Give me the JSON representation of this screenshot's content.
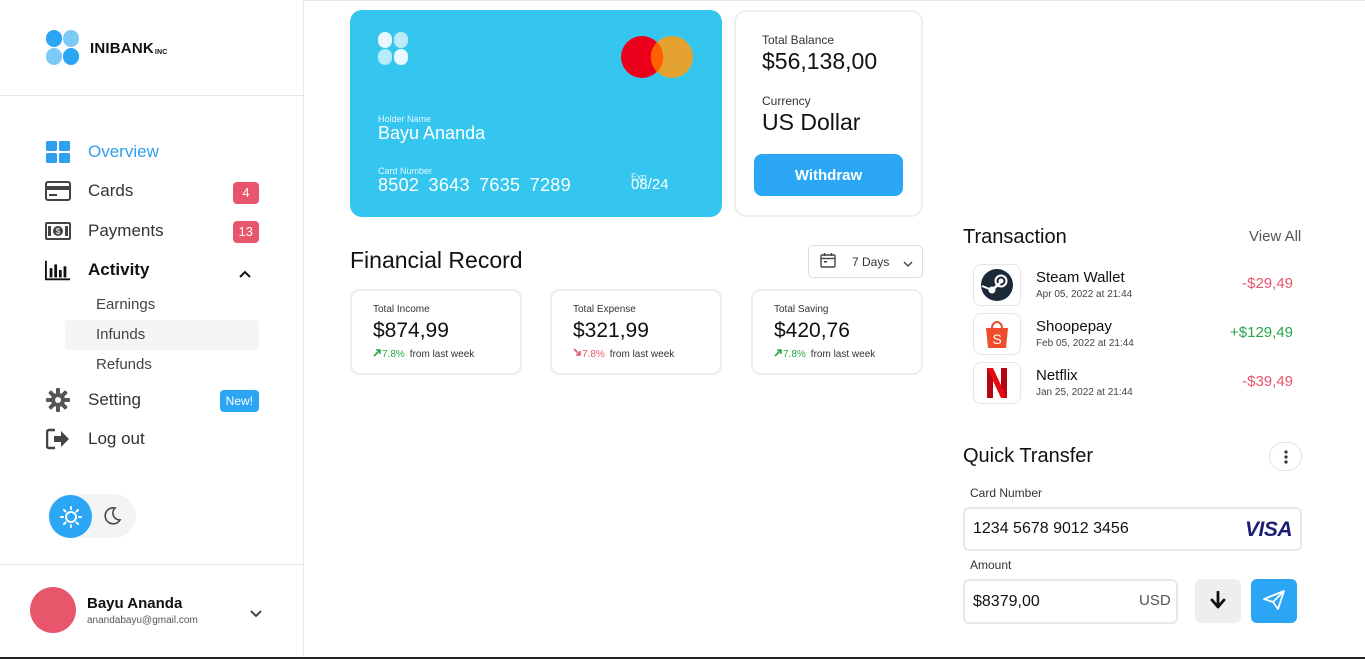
{
  "brand": {
    "name": "INIBANK",
    "suffix": "INC"
  },
  "sidebar": {
    "nav": [
      {
        "label": "Overview",
        "icon": "grid-icon",
        "active": true
      },
      {
        "label": "Cards",
        "icon": "credit-card-icon",
        "badge": "4"
      },
      {
        "label": "Payments",
        "icon": "banknote-icon",
        "badge": "13"
      },
      {
        "label": "Activity",
        "icon": "bar-chart-icon",
        "expanded": true
      }
    ],
    "activity_sub": [
      {
        "label": "Earnings"
      },
      {
        "label": "Infunds",
        "selected": true
      },
      {
        "label": "Refunds"
      }
    ],
    "setting": {
      "label": "Setting",
      "icon": "gear-icon",
      "badge": "New!"
    },
    "logout": {
      "label": "Log out",
      "icon": "logout-icon"
    },
    "theme": {
      "current": "light"
    }
  },
  "profile": {
    "name": "Bayu Ananda",
    "email": "anandabayu@gmail.com"
  },
  "card": {
    "holder_label": "Holder Name",
    "holder": "Bayu Ananda",
    "number_label": "Card Number",
    "number": "8502 3643 7635 7289",
    "exp_label": "Exp",
    "exp": "08/24",
    "network": "mastercard"
  },
  "balance": {
    "total_label": "Total Balance",
    "total": "$56,138,00",
    "currency_label": "Currency",
    "currency": "US Dollar",
    "withdraw": "Withdraw"
  },
  "financial": {
    "title": "Financial Record",
    "range": "7 Days",
    "stats": [
      {
        "label": "Total Income",
        "value": "$874,99",
        "change": "7.8%",
        "direction": "up",
        "note": "from last week"
      },
      {
        "label": "Total Expense",
        "value": "$321,99",
        "change": "7.8%",
        "direction": "down",
        "note": "from last week"
      },
      {
        "label": "Total Saving",
        "value": "$420,76",
        "change": "7.8%",
        "direction": "up",
        "note": "from last week"
      }
    ]
  },
  "transactions": {
    "title": "Transaction",
    "view_all": "View All",
    "items": [
      {
        "name": "Steam Wallet",
        "date": "Apr 05, 2022 at 21:44",
        "amount": "-$29,49",
        "type": "neg",
        "icon": "steam-icon"
      },
      {
        "name": "Shoopepay",
        "date": "Feb 05, 2022 at 21:44",
        "amount": "+$129,49",
        "type": "pos",
        "icon": "shopee-icon"
      },
      {
        "name": "Netflix",
        "date": "Jan 25, 2022 at 21:44",
        "amount": "-$39,49",
        "type": "neg",
        "icon": "netflix-icon"
      }
    ]
  },
  "quick_transfer": {
    "title": "Quick Transfer",
    "card_label": "Card Number",
    "card_value": "1234 5678 9012 3456",
    "card_network": "VISA",
    "amount_label": "Amount",
    "amount_value": "$8379,00",
    "currency": "USD"
  },
  "colors": {
    "accent": "#2aa6f5",
    "card": "#34c6ef",
    "badge": "#e8566c",
    "positive": "#27a745",
    "negative": "#e8566c"
  }
}
